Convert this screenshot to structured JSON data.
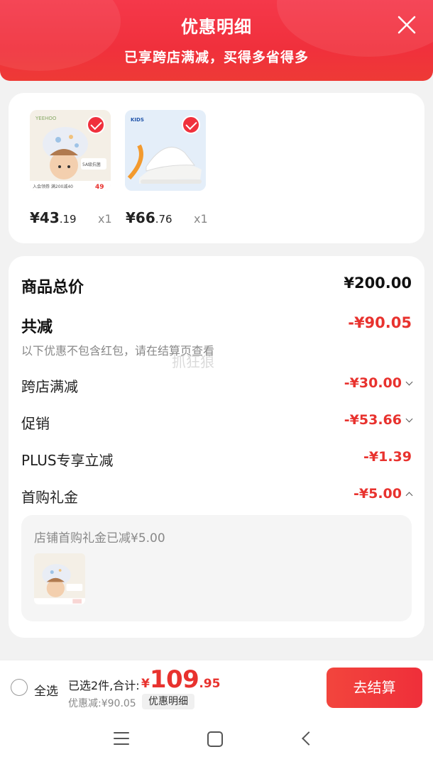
{
  "header": {
    "title": "优惠明细",
    "subtitle": "已享跨店满减，买得多省得多"
  },
  "products": [
    {
      "price_int": "¥43",
      "price_dec": ".19",
      "qty": "x1",
      "brand": "YEEHOO",
      "badge": "5A级抗菌",
      "promo": "入会领券 满200减40",
      "tag_price": "49"
    },
    {
      "price_int": "¥66",
      "price_dec": ".76",
      "qty": "x1",
      "brand": "KIDS"
    }
  ],
  "summary": {
    "total_label": "商品总价",
    "total_value": "¥200.00",
    "reduce_label": "共减",
    "reduce_value": "-¥90.05",
    "note": "以下优惠不包含红包，请在结算页查看",
    "items": [
      {
        "label": "跨店满减",
        "value": "-¥30.00",
        "chevron": "down"
      },
      {
        "label": "促销",
        "value": "-¥53.66",
        "chevron": "down"
      },
      {
        "label": "PLUS专享立减",
        "value": "-¥1.39",
        "chevron": "none"
      },
      {
        "label": "首购礼金",
        "value": "-¥5.00",
        "chevron": "up"
      }
    ],
    "gift_text": "店铺首购礼金已减¥5.00"
  },
  "watermark": "抓狂狼",
  "bottom_bar": {
    "select_all": "全选",
    "selected_info": "已选2件,合计:",
    "total_currency": "¥",
    "total_int": "109",
    "total_dec": ".95",
    "discount_info": "优惠减:¥90.05",
    "detail_tag": "优惠明细",
    "checkout": "去结算"
  },
  "colors": {
    "accent": "#f0303c",
    "price_red": "#e8322e"
  }
}
